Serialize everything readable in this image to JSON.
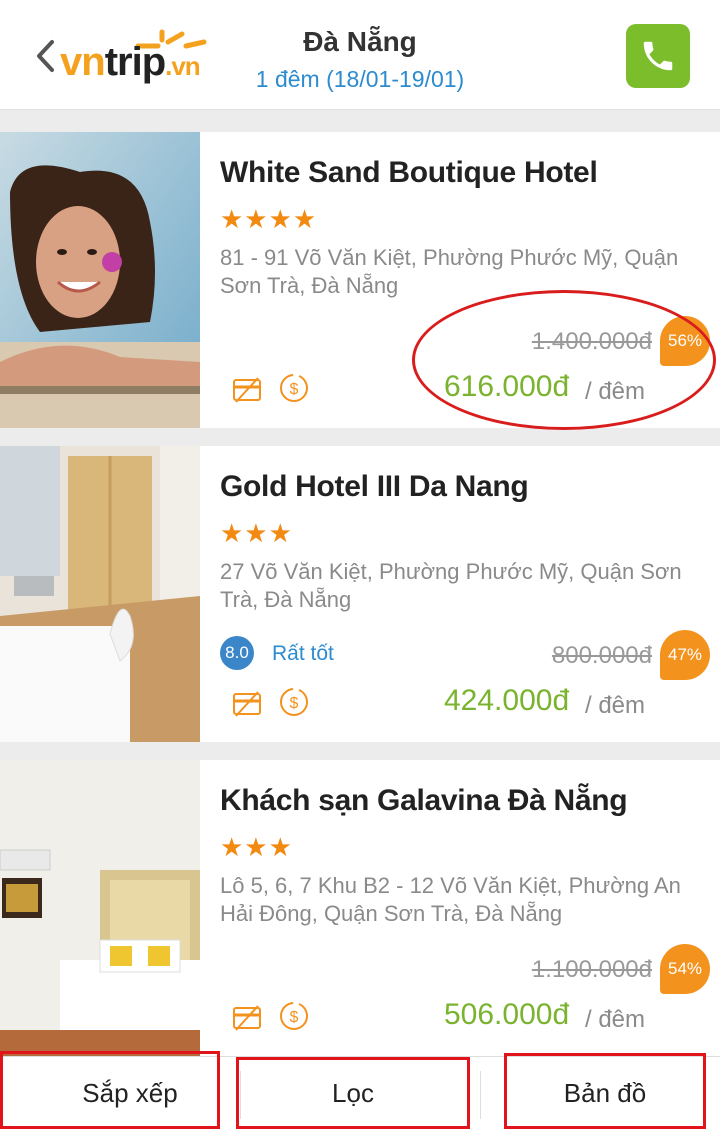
{
  "header": {
    "logo": {
      "vn": "vn",
      "trip": "trip",
      "dot": ".vn"
    },
    "title": "Đà Nẵng",
    "subtitle": "1 đêm (18/01-19/01)",
    "icons": {
      "back": "chevron-left-icon",
      "call": "phone-icon"
    }
  },
  "colors": {
    "accent": "#f4921e",
    "price": "#7ab32e",
    "link": "#2d8bcf",
    "call": "#7cbd2b",
    "annotation": "#d91c1c"
  },
  "hotels": [
    {
      "name": "White Sand Boutique Hotel",
      "stars": "★★★★",
      "address": "81 - 91 Võ Văn Kiệt, Phường Phước Mỹ, Quận Sơn Trà, Đà Nẵng",
      "old_price": "1.400.000đ",
      "discount": "56%",
      "price": "616.000đ",
      "per": "/ đêm"
    },
    {
      "name": "Gold Hotel III Da Nang",
      "stars": "★★★",
      "address": "27 Võ Văn Kiệt, Phường Phước Mỹ, Quận Sơn Trà, Đà Nẵng",
      "rating": "8.0",
      "rating_label": "Rất tốt",
      "old_price": "800.000đ",
      "discount": "47%",
      "price": "424.000đ",
      "per": "/ đêm"
    },
    {
      "name": "Khách sạn Galavina Đà Nẵng",
      "stars": "★★★",
      "address": "Lô 5, 6, 7 Khu B2 - 12 Võ Văn Kiệt, Phường An Hải Đông, Quận Sơn Trà, Đà Nẵng",
      "old_price": "1.100.000đ",
      "discount": "54%",
      "price": "506.000đ",
      "per": "/ đêm"
    }
  ],
  "bottom_bar": {
    "sort": "Sắp xếp",
    "filter": "Lọc",
    "map": "Bản đồ"
  }
}
